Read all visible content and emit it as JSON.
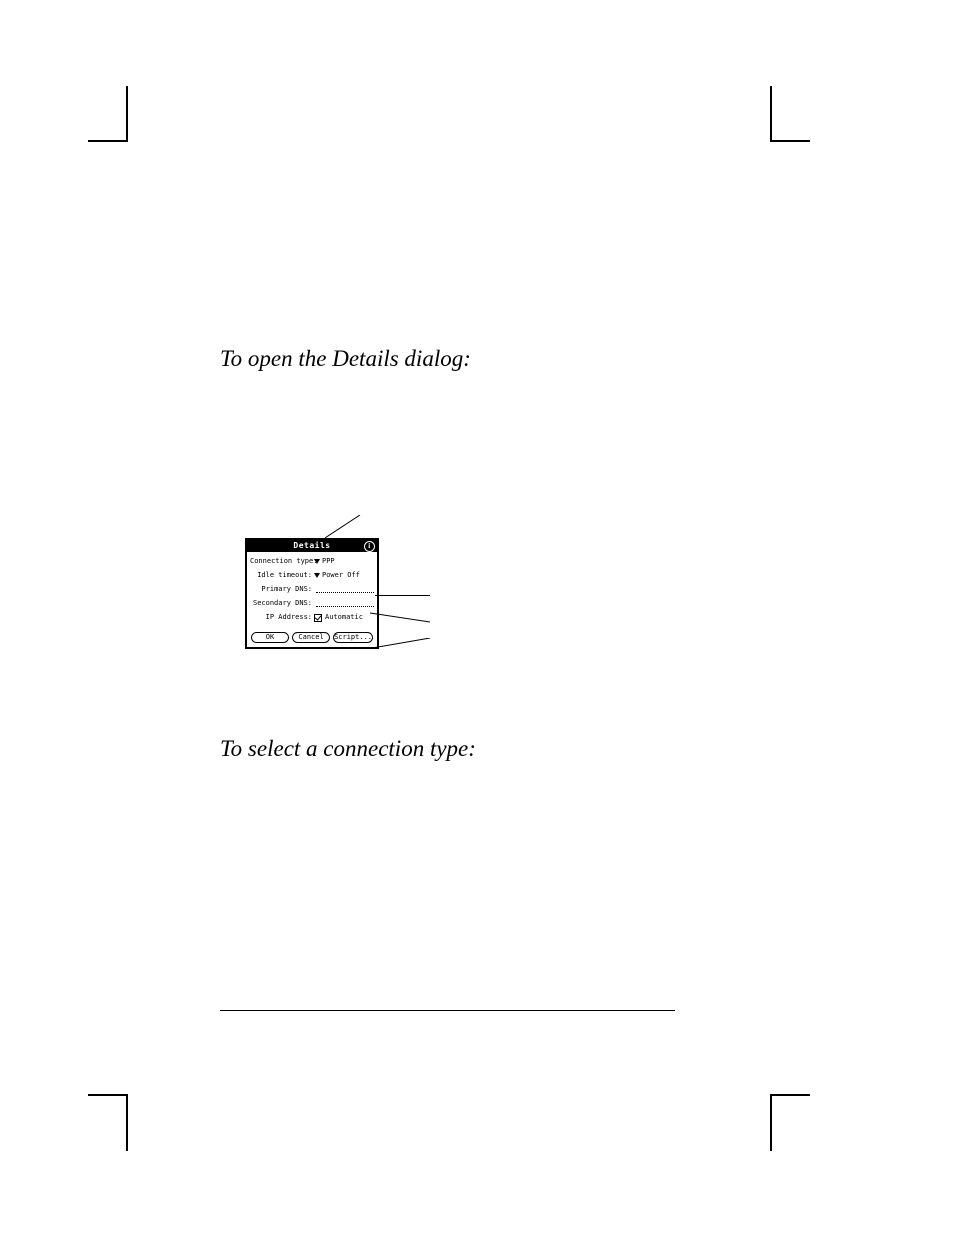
{
  "headings": {
    "open_details": "To open the Details dialog:",
    "select_conn": "To select a connection type:"
  },
  "dialog": {
    "title": "Details",
    "info_glyph": "i",
    "rows": {
      "conn_type": {
        "label": "Connection type:",
        "value": "PPP"
      },
      "idle": {
        "label": "Idle timeout:",
        "value": "Power Off"
      },
      "pdns": {
        "label": "Primary DNS:",
        "value": ""
      },
      "sdns": {
        "label": "Secondary DNS:",
        "value": ""
      },
      "ip": {
        "label": "IP Address:",
        "value": "Automatic",
        "checked": true
      }
    },
    "buttons": {
      "ok": "OK",
      "cancel": "Cancel",
      "script": "Script..."
    }
  }
}
